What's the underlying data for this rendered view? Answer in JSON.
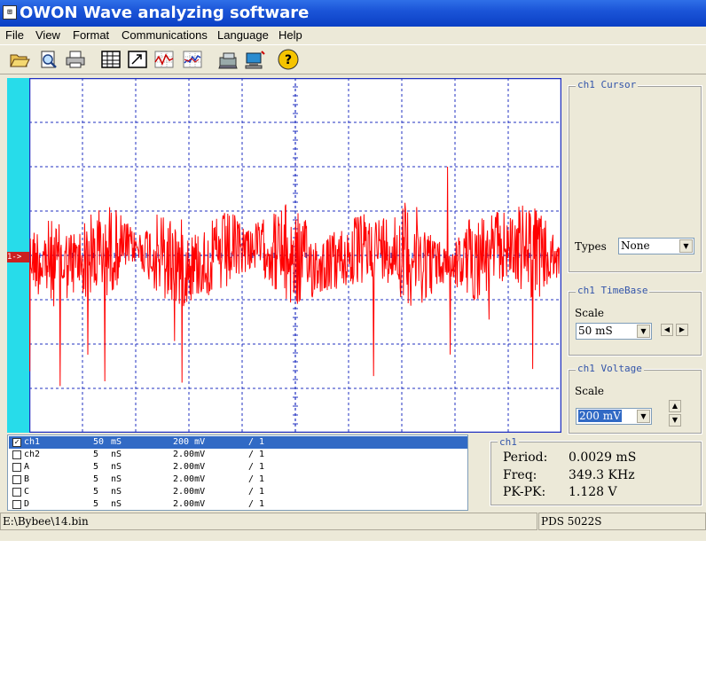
{
  "title_bar": {
    "title": "OWON Wave analyzing software",
    "icon": "app-icon"
  },
  "menu": [
    "File",
    "View",
    "Format",
    "Communications",
    "Language",
    "Help"
  ],
  "toolbar": {
    "buttons": [
      "open-icon",
      "print-preview-icon",
      "print-icon",
      "table-icon",
      "export-icon",
      "waveform-icon",
      "fft-icon",
      "device-icon",
      "connect-icon",
      "help-icon"
    ]
  },
  "scope": {
    "channel_marker": "1->",
    "trace_color": "#ff0000",
    "grid_color": "#2030c0",
    "left_strip_color": "#27dcea"
  },
  "cursor_panel": {
    "legend": "ch1 Cursor",
    "types_label": "Types",
    "types_value": "None"
  },
  "timebase_panel": {
    "legend": "ch1 TimeBase",
    "scale_label": "Scale",
    "scale_value": "50 mS"
  },
  "voltage_panel": {
    "legend": "ch1 Voltage",
    "scale_label": "Scale",
    "scale_value": "200 mV"
  },
  "channels": [
    {
      "checked": true,
      "name": "ch1",
      "tb_num": "50",
      "tb_unit": "mS",
      "volt": "200 mV",
      "probe": "/ 1"
    },
    {
      "checked": false,
      "name": "ch2",
      "tb_num": "5",
      "tb_unit": "nS",
      "volt": "2.00mV",
      "probe": "/ 1"
    },
    {
      "checked": false,
      "name": "A",
      "tb_num": "5",
      "tb_unit": "nS",
      "volt": "2.00mV",
      "probe": "/ 1"
    },
    {
      "checked": false,
      "name": "B",
      "tb_num": "5",
      "tb_unit": "nS",
      "volt": "2.00mV",
      "probe": "/ 1"
    },
    {
      "checked": false,
      "name": "C",
      "tb_num": "5",
      "tb_unit": "nS",
      "volt": "2.00mV",
      "probe": "/ 1"
    },
    {
      "checked": false,
      "name": "D",
      "tb_num": "5",
      "tb_unit": "nS",
      "volt": "2.00mV",
      "probe": "/ 1"
    }
  ],
  "measurements": {
    "legend": "ch1",
    "period_label": "Period:",
    "period_value": "0.0029 mS",
    "freq_label": "Freq:",
    "freq_value": "349.3 KHz",
    "pkpk_label": "PK-PK:",
    "pkpk_value": "1.128 V"
  },
  "status_bar": {
    "file_path": "E:\\Bybee\\14.bin",
    "device": "PDS 5022S"
  }
}
